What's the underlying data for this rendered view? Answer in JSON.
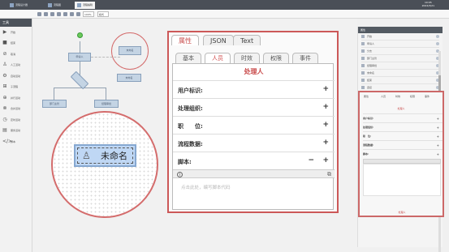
{
  "app": {
    "tabs": [
      "流程设计器",
      "流程图",
      "流程编辑"
    ],
    "clock_time": "10:05",
    "clock_date": "2022/3/21"
  },
  "toolbar": {
    "zoom_value": "100%",
    "mode_value": "模式"
  },
  "sidebar": {
    "title": "工具",
    "items": [
      {
        "label": "开始",
        "icon": "play-icon"
      },
      {
        "label": "结束",
        "icon": "stop-icon"
      },
      {
        "label": "取消",
        "icon": "cancel-icon"
      },
      {
        "label": "人工活动",
        "icon": "user-icon"
      },
      {
        "label": "自动活动",
        "icon": "gear-icon"
      },
      {
        "label": "子流程",
        "icon": "subprocess-icon"
      },
      {
        "label": "并行活动",
        "icon": "parallel-icon"
      },
      {
        "label": "合并活动",
        "icon": "merge-icon"
      },
      {
        "label": "定时活动",
        "icon": "timer-icon"
      },
      {
        "label": "服务活动",
        "icon": "service-icon"
      },
      {
        "label": "脚本",
        "icon": "code-icon"
      }
    ]
  },
  "canvas": {
    "nodes": [
      "开始",
      "申请人",
      "分支",
      "部门主管",
      "经理审批",
      "未命名",
      "结束"
    ],
    "zoom_node_label": "未命名"
  },
  "panel": {
    "tabs": [
      "属性",
      "JSON",
      "Text"
    ],
    "sub_tabs": [
      "基本",
      "人员",
      "时效",
      "权限",
      "事件"
    ],
    "title": "处理人",
    "rows": [
      {
        "label": "用户标识:",
        "action": "+"
      },
      {
        "label": "处理组织:",
        "action": "+"
      },
      {
        "label": "职　　位:",
        "action": "+"
      },
      {
        "label": "流程数据:",
        "action": "+"
      },
      {
        "label": "脚本:",
        "action": "+",
        "secondary": "−"
      }
    ],
    "placeholder": "点击此处，编写脚本代码"
  },
  "props": {
    "header": "属性",
    "layers": [
      "开始",
      "申请人",
      "分支",
      "部门主管",
      "经理审批",
      "未命名",
      "结束",
      "连接",
      "连接"
    ],
    "tabs": [
      "属性",
      "人员",
      "时效",
      "权限",
      "事件"
    ],
    "title": "处理人",
    "rows": [
      "用户标识:",
      "处理组织:",
      "职　位:",
      "流程数据:",
      "脚本:"
    ],
    "footer": "处理人"
  }
}
